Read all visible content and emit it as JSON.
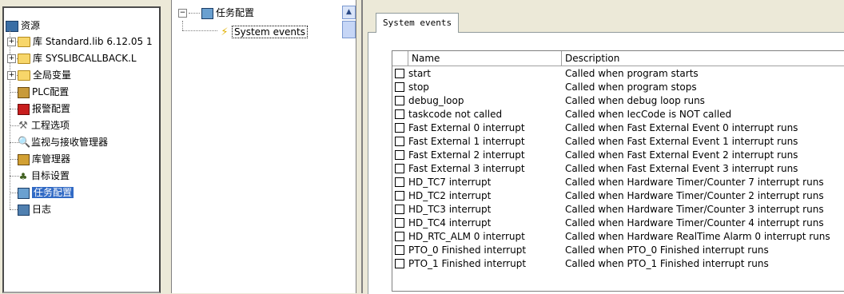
{
  "resources": {
    "root_label": "资源",
    "items": [
      {
        "label": "库 Standard.lib 6.12.05 1",
        "expander": "+",
        "icon": "folder-icon"
      },
      {
        "label": "库 SYSLIBCALLBACK.L",
        "expander": "+",
        "icon": "folder-icon"
      },
      {
        "label": "全局变量",
        "expander": "+",
        "icon": "folder-icon"
      },
      {
        "label": "PLC配置",
        "icon": "plc-config-icon"
      },
      {
        "label": "报警配置",
        "icon": "alarm-icon"
      },
      {
        "label": "工程选项",
        "icon": "tools-icon"
      },
      {
        "label": "监视与接收管理器",
        "icon": "magnifier-icon"
      },
      {
        "label": "库管理器",
        "icon": "library-icon"
      },
      {
        "label": "目标设置",
        "icon": "target-icon"
      },
      {
        "label": "任务配置",
        "icon": "task-config-icon",
        "selected": true
      },
      {
        "label": "日志",
        "icon": "log-icon"
      }
    ]
  },
  "task_tree": {
    "root_label": "任务配置",
    "child_label": "System events"
  },
  "tab": {
    "label": "System events"
  },
  "table": {
    "columns": [
      "Name",
      "Description"
    ],
    "rows": [
      {
        "name": "start",
        "description": "Called when program starts"
      },
      {
        "name": "stop",
        "description": "Called when program stops"
      },
      {
        "name": "debug_loop",
        "description": "Called when debug loop runs"
      },
      {
        "name": "taskcode not called",
        "description": "Called when IecCode is NOT called"
      },
      {
        "name": "Fast External 0 interrupt",
        "description": "Called when Fast External Event 0 interrupt runs"
      },
      {
        "name": "Fast External 1 interrupt",
        "description": "Called when Fast External Event 1 interrupt runs"
      },
      {
        "name": "Fast External 2 interrupt",
        "description": "Called when Fast External Event 2 interrupt runs"
      },
      {
        "name": "Fast External 3 interrupt",
        "description": "Called when Fast External Event 3 interrupt runs"
      },
      {
        "name": "HD_TC7 interrupt",
        "description": "Called when Hardware Timer/Counter 7 interrupt runs"
      },
      {
        "name": "HD_TC2 interrupt",
        "description": "Called when Hardware Timer/Counter 2 interrupt runs"
      },
      {
        "name": "HD_TC3 interrupt",
        "description": "Called when Hardware Timer/Counter 3 interrupt runs"
      },
      {
        "name": "HD_TC4 interrupt",
        "description": "Called when Hardware Timer/Counter 4 interrupt runs"
      },
      {
        "name": "HD_RTC_ALM 0 interrupt",
        "description": "Called when Hardware RealTime Alarm 0 interrupt runs"
      },
      {
        "name": "PTO_0 Finished interrupt",
        "description": "Called when PTO_0 Finished interrupt runs"
      },
      {
        "name": "PTO_1 Finished interrupt",
        "description": "Called when PTO_1 Finished interrupt runs"
      }
    ]
  },
  "colors": {
    "selection": "#316ac5",
    "panel_bg": "#ece9d8"
  }
}
